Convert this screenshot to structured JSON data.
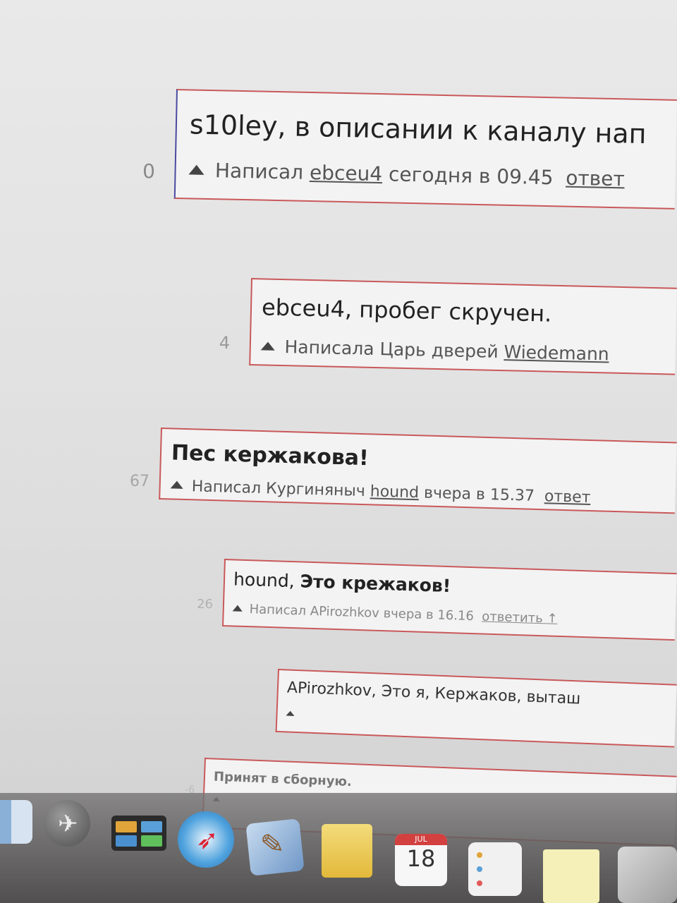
{
  "comments": [
    {
      "score": "0",
      "text": "s10ley, в описании к каналу нап",
      "meta": {
        "prefix": "Написал",
        "author": "ebceu4",
        "time": "сегодня в 09.45",
        "reply": "ответ"
      }
    },
    {
      "score": "4",
      "text": "ebceu4, пробег скручен.",
      "meta": {
        "prefix": "Написала Царь дверей",
        "author": "Wiedemann"
      }
    },
    {
      "score": "67",
      "text": "Пес кержакова!",
      "meta": {
        "prefix": "Написал Кургиняныч",
        "author": "hound",
        "time": "вчера в 15.37",
        "reply": "ответ"
      }
    },
    {
      "score": "26",
      "mention": "hound,",
      "text": "Это крежаков!",
      "meta": {
        "prefix": "Написал",
        "author": "APirozhkov",
        "time": "вчера в 16.16",
        "reply": "ответить ↑"
      }
    },
    {
      "text": "APirozhkov, Это я, Кержаков, выташ"
    },
    {
      "score": "-6",
      "text": "Принят в сборную."
    }
  ],
  "dock": {
    "calendar_month": "JUL",
    "calendar_day": "18"
  }
}
